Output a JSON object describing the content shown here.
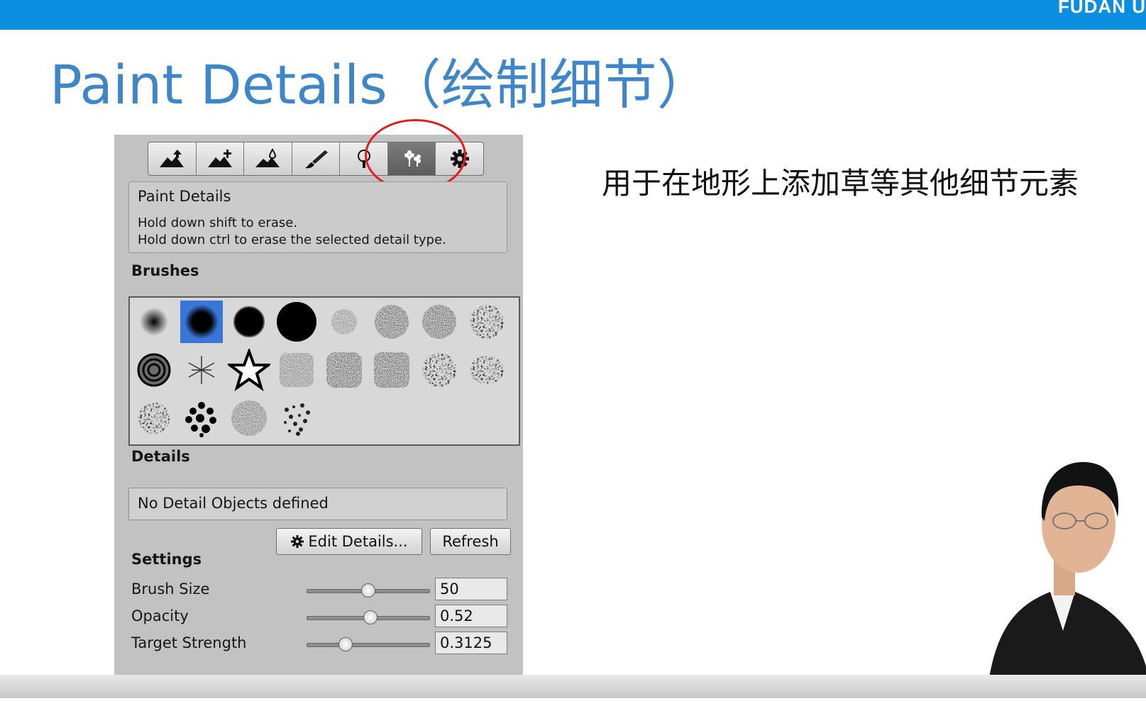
{
  "header": {
    "brand": "FUDAN U"
  },
  "slide": {
    "title": "Paint Details（绘制细节）",
    "description": "用于在地形上添加草等其他细节元素"
  },
  "inspector": {
    "toolbar": {
      "tools": [
        {
          "name": "raise-lower-terrain",
          "icon": "mountain-arrow-icon",
          "active": false
        },
        {
          "name": "paint-height",
          "icon": "mountain-plus-icon",
          "active": false
        },
        {
          "name": "smooth-height",
          "icon": "mountain-drop-icon",
          "active": false
        },
        {
          "name": "paint-texture",
          "icon": "brush-icon",
          "active": false
        },
        {
          "name": "place-trees",
          "icon": "tree-icon",
          "active": false
        },
        {
          "name": "paint-details",
          "icon": "flowers-icon",
          "active": true
        },
        {
          "name": "terrain-settings",
          "icon": "gear-icon",
          "active": false
        }
      ]
    },
    "info": {
      "title": "Paint Details",
      "line1": "Hold down shift to erase.",
      "line2": "Hold down ctrl to erase the selected detail type."
    },
    "brushes_label": "Brushes",
    "brushes_selected_index": 1,
    "details_label": "Details",
    "details_message": "No Detail Objects defined",
    "edit_details_label": "Edit Details...",
    "refresh_label": "Refresh",
    "settings_label": "Settings",
    "settings": [
      {
        "label": "Brush Size",
        "value": "50",
        "fraction": 0.5
      },
      {
        "label": "Opacity",
        "value": "0.52",
        "fraction": 0.52
      },
      {
        "label": "Target Strength",
        "value": "0.3125",
        "fraction": 0.3125
      }
    ]
  },
  "colors": {
    "topbar": "#0a8fe0",
    "title": "#3f86c9",
    "selection": "#3a75d8",
    "highlight_circle": "#e11c1c"
  }
}
